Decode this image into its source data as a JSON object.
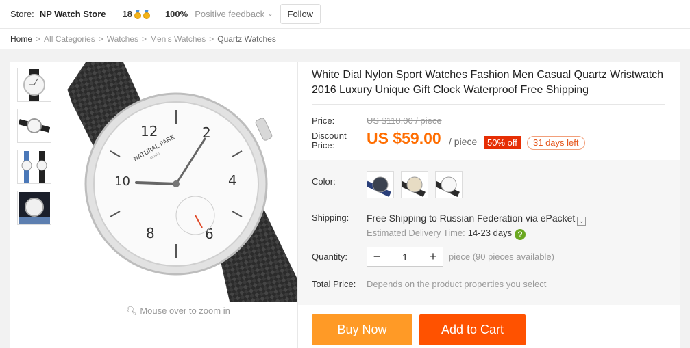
{
  "store": {
    "label": "Store:",
    "name": "NP Watch Store",
    "score": "18",
    "positive_pct": "100%",
    "positive_label": "Positive feedback",
    "follow_label": "Follow"
  },
  "breadcrumb": [
    "Home",
    "All Categories",
    "Watches",
    "Men's Watches",
    "Quartz Watches"
  ],
  "breadcrumb_sep": ">",
  "product": {
    "title": "White Dial Nylon Sport Watches Fashion Men Casual Quartz Wristwatch 2016 Luxury Unique Gift Clock Waterproof Free Shipping",
    "zoom_hint": "Mouse over to zoom in",
    "price_label": "Price:",
    "old_price": "US $118.00 / piece",
    "discount_label_1": "Discount",
    "discount_label_2": "Price:",
    "price": "US $59.00",
    "per_piece": "/ piece",
    "off_badge": "50% off",
    "days_left": "31 days left",
    "color_label": "Color:",
    "shipping_label": "Shipping:",
    "shipping_free": "Free Shipping",
    "shipping_to": "to",
    "shipping_rest": "Russian Federation via ePacket",
    "est_label": "Estimated Delivery Time:",
    "est_days": "14-23  days",
    "quantity_label": "Quantity:",
    "quantity_value": "1",
    "quantity_avail": "piece (90 pieces available)",
    "total_label": "Total Price:",
    "total_text": "Depends on the product properties you select",
    "buy_now": "Buy Now",
    "add_to_cart": "Add to Cart"
  },
  "dial_text": {
    "brand": "NATURAL PARK",
    "sub": "studio",
    "n12": "12",
    "n2": "2",
    "n4": "4",
    "n6": "6",
    "n8": "8",
    "n10": "10"
  },
  "colors": {
    "accent_orange": "#ff6d00",
    "buy_now": "#ff9a26",
    "add_to_cart": "#ff5200",
    "off_badge": "#e62e04"
  }
}
